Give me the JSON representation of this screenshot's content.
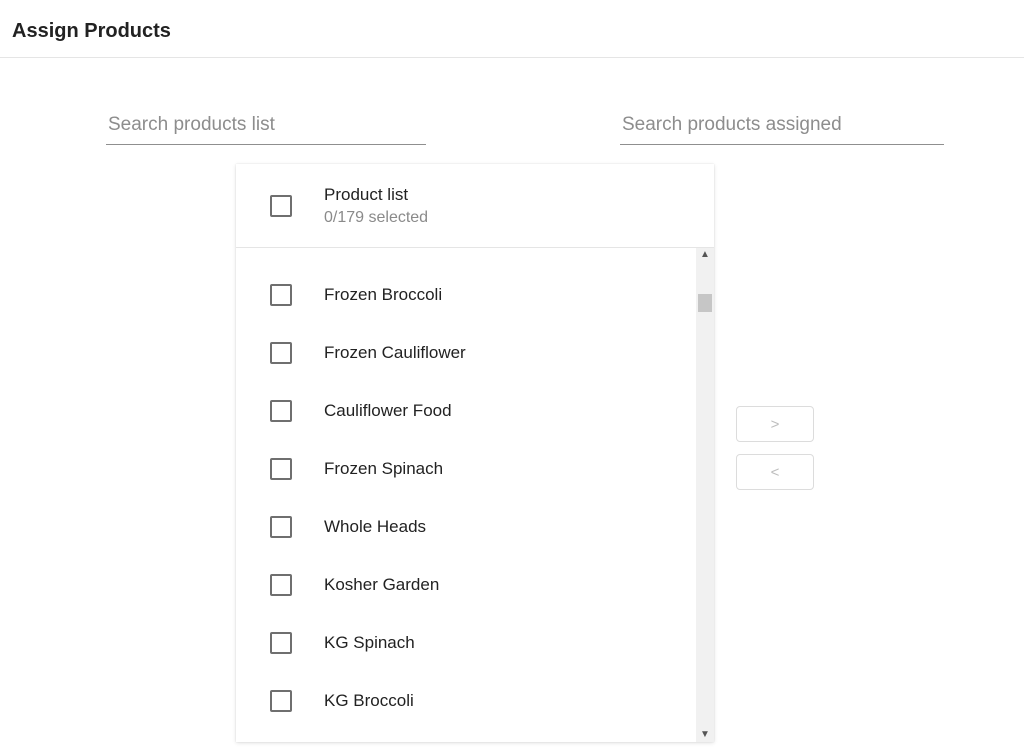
{
  "title": "Assign Products",
  "search": {
    "left_placeholder": "Search products list",
    "right_placeholder": "Search products assigned"
  },
  "product_list": {
    "header_title": "Product list",
    "selected_count": 0,
    "total_count": 179,
    "header_sub": "0/179 selected",
    "items": [
      {
        "label": "Frozen Broccoli"
      },
      {
        "label": "Frozen Cauliflower"
      },
      {
        "label": "Cauliflower Food"
      },
      {
        "label": "Frozen Spinach"
      },
      {
        "label": "Whole Heads"
      },
      {
        "label": "Kosher Garden"
      },
      {
        "label": "KG Spinach"
      },
      {
        "label": "KG Broccoli"
      }
    ]
  },
  "transfer": {
    "add_label": ">",
    "remove_label": "<"
  }
}
